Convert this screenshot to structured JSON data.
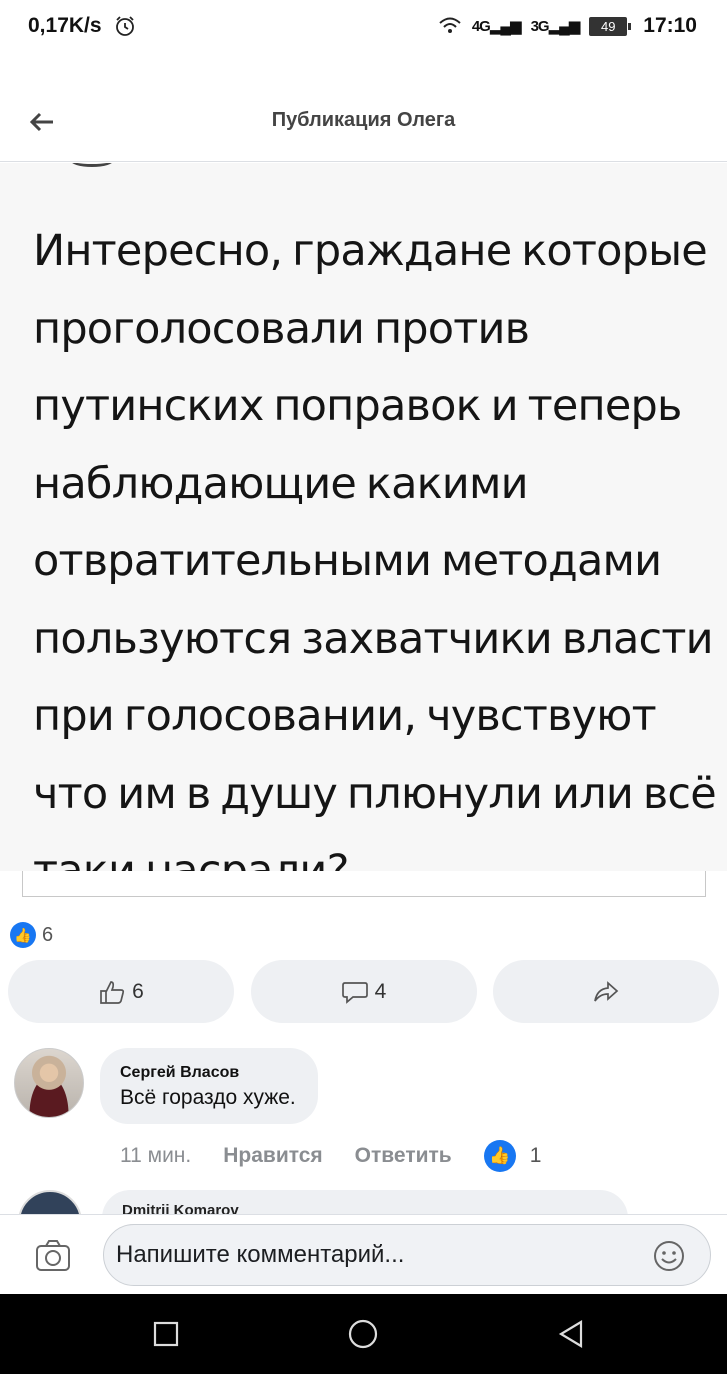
{
  "status_bar": {
    "speed": "0,17K/s",
    "alarm_icon": "alarm-clock-icon",
    "wifi_icon": "wifi-icon",
    "signal1": "4G",
    "signal2": "3G",
    "battery": "49",
    "time": "17:10"
  },
  "header": {
    "title": "Публикация Олега",
    "back_icon": "arrow-left-icon"
  },
  "post": {
    "image_text": "Интересно, граждане которые проголосовали против путинских поправок и теперь наблюдающие какими отвратительными методами пользуются захватчики власти при голосовании, чувствуют что им в душу плюнули или всё таки насрали?"
  },
  "reactions": {
    "count": "6"
  },
  "actions": {
    "like_count": "6",
    "comment_count": "4"
  },
  "comments": [
    {
      "author": "Сергей Власов",
      "text": "Всё гораздо хуже.",
      "time": "11 мин.",
      "like_label": "Нравится",
      "reply_label": "Ответить",
      "reactions": "1"
    }
  ],
  "next_comment": {
    "author": "Dmitrii Komarov"
  },
  "composer": {
    "placeholder": "Напишите комментарий..."
  },
  "colors": {
    "accent": "#1877f2",
    "bubble": "#eef0f3"
  }
}
